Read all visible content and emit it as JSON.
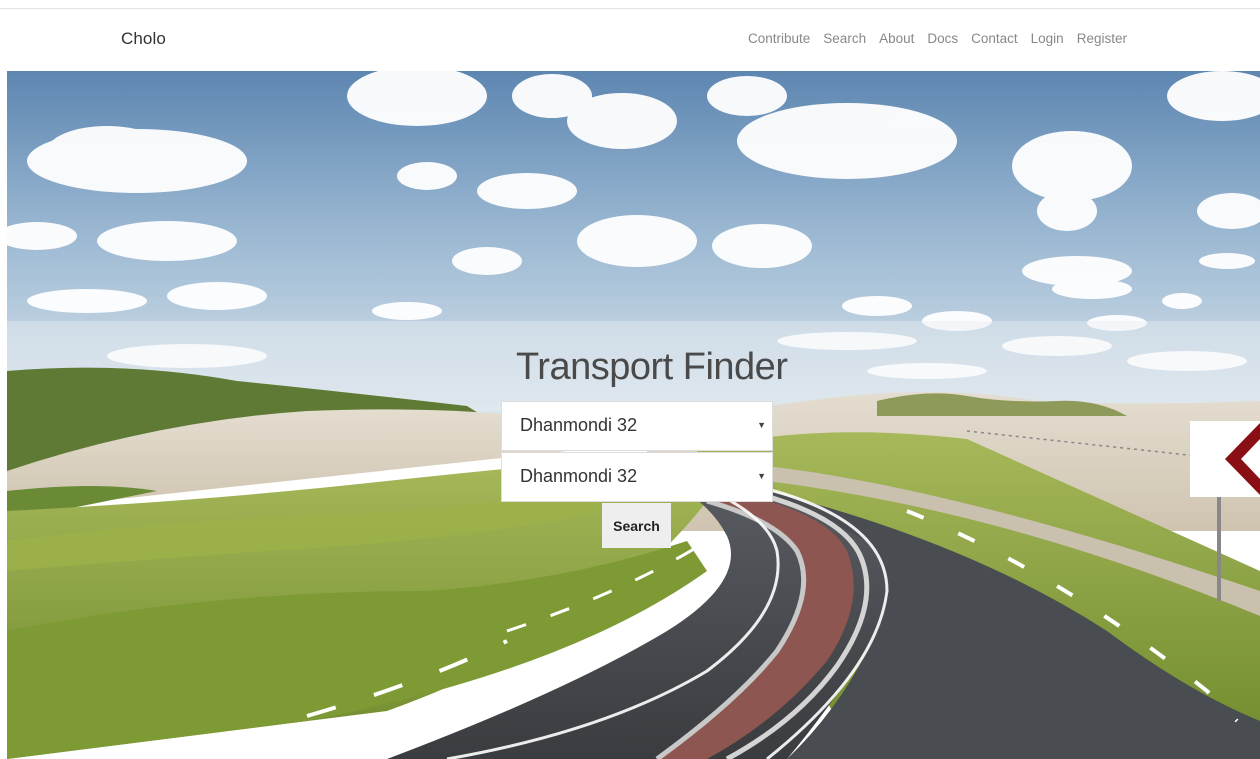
{
  "navbar": {
    "brand": "Cholo",
    "links": [
      "Contribute",
      "Search",
      "About",
      "Docs",
      "Contact",
      "Login",
      "Register"
    ]
  },
  "hero": {
    "title": "Transport Finder",
    "from_value": "Dhanmondi 32",
    "to_value": "Dhanmondi 32",
    "search_label": "Search"
  }
}
